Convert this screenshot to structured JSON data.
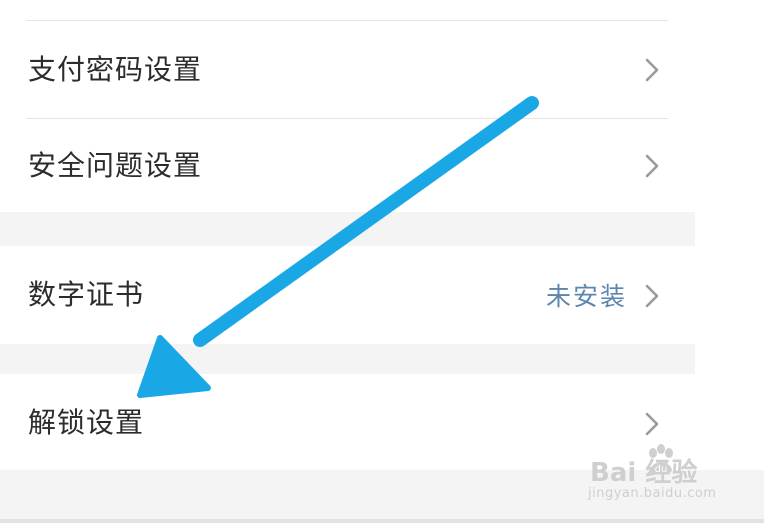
{
  "settings": {
    "items": [
      {
        "label": "支付密码设置",
        "value": ""
      },
      {
        "label": "安全问题设置",
        "value": ""
      },
      {
        "label": "数字证书",
        "value": "未安装"
      },
      {
        "label": "解锁设置",
        "value": ""
      }
    ]
  },
  "icons": {
    "chevron": "chevron-right-icon",
    "arrow": "blue-arrow-annotation"
  },
  "watermark": {
    "brand": "Bai  经验",
    "url": "jingyan.baidu.com"
  },
  "colors": {
    "label": "#2c2c2c",
    "value_link": "#5b86ad",
    "chevron": "#9a9a9a",
    "section_gap": "#f4f4f4",
    "arrow": "#1aa7e6"
  }
}
